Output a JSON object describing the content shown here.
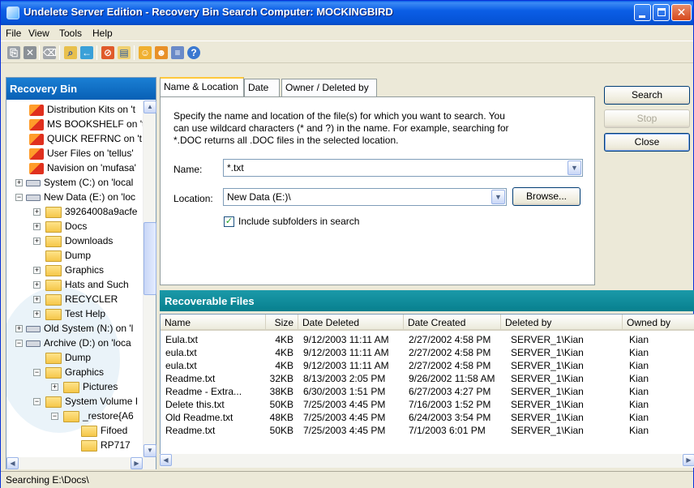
{
  "window": {
    "title": "Undelete Server Edition - Recovery Bin Search   Computer: MOCKINGBIRD"
  },
  "menu": [
    "File",
    "View",
    "Tools",
    "Help"
  ],
  "toolbar_icons": [
    "recover-icon",
    "delete-icon",
    "purge-icon",
    "search-icon",
    "back-icon",
    "filter-icon",
    "properties-icon",
    "users-icon",
    "user-settings-icon",
    "options-icon",
    "help-icon"
  ],
  "recovery_bin": {
    "header": "Recovery Bin",
    "tree": [
      {
        "label": "Distribution Kits on 't",
        "icon": "recovery-bin-icon"
      },
      {
        "label": "MS BOOKSHELF on 't",
        "icon": "recovery-bin-icon"
      },
      {
        "label": "QUICK REFRNC on 't",
        "icon": "recovery-bin-icon"
      },
      {
        "label": "User Files on 'tellus'",
        "icon": "recovery-bin-icon"
      },
      {
        "label": "Navision on 'mufasa'",
        "icon": "recovery-bin-icon"
      },
      {
        "label": "System (C:) on 'local",
        "icon": "drive-icon"
      },
      {
        "label": "New Data (E:) on 'loc",
        "icon": "drive-icon"
      },
      {
        "label": "39264008a9acfe",
        "icon": "folder-icon"
      },
      {
        "label": "Docs",
        "icon": "folder-icon"
      },
      {
        "label": "Downloads",
        "icon": "folder-icon"
      },
      {
        "label": "Dump",
        "icon": "folder-icon"
      },
      {
        "label": "Graphics",
        "icon": "folder-icon"
      },
      {
        "label": "Hats and Such",
        "icon": "folder-icon"
      },
      {
        "label": "RECYCLER",
        "icon": "folder-icon"
      },
      {
        "label": "Test Help",
        "icon": "folder-icon"
      },
      {
        "label": "Old System (N:) on 'l",
        "icon": "drive-icon"
      },
      {
        "label": "Archive (D:) on 'loca",
        "icon": "drive-icon"
      },
      {
        "label": "Dump",
        "icon": "folder-icon"
      },
      {
        "label": "Graphics",
        "icon": "folder-icon"
      },
      {
        "label": "Pictures",
        "icon": "folder-icon"
      },
      {
        "label": "System Volume I",
        "icon": "folder-icon"
      },
      {
        "label": "_restore{A6",
        "icon": "folder-icon"
      },
      {
        "label": "Fifoed",
        "icon": "folder-icon"
      },
      {
        "label": "RP717",
        "icon": "folder-icon"
      }
    ]
  },
  "tabs": [
    "Name & Location",
    "Date",
    "Owner / Deleted by"
  ],
  "search_form": {
    "description": "Specify the name and location of the file(s) for which you want to search. You can use wildcard characters (* and ?) in the name. For example, searching for *.DOC returns all .DOC files in the selected location.",
    "name_label": "Name:",
    "name_value": "*.txt",
    "location_label": "Location:",
    "location_value": "New Data (E:)\\",
    "browse_label": "Browse...",
    "include_subfolders_label": "Include subfolders in search",
    "include_subfolders_checked": true
  },
  "actions": {
    "search": "Search",
    "stop": "Stop",
    "close": "Close"
  },
  "results": {
    "header": "Recoverable Files",
    "columns": [
      "Name",
      "Size",
      "Date Deleted",
      "Date Created",
      "Deleted by",
      "Owned by"
    ],
    "rows": [
      [
        "Eula.txt",
        "4KB",
        "9/12/2003 11:11 AM",
        "2/27/2002 4:58 PM",
        "SERVER_1\\Kian",
        "Kian"
      ],
      [
        "eula.txt",
        "4KB",
        "9/12/2003 11:11 AM",
        "2/27/2002 4:58 PM",
        "SERVER_1\\Kian",
        "Kian"
      ],
      [
        "eula.txt",
        "4KB",
        "9/12/2003 11:11 AM",
        "2/27/2002 4:58 PM",
        "SERVER_1\\Kian",
        "Kian"
      ],
      [
        "Readme.txt",
        "32KB",
        "8/13/2003 2:05 PM",
        "9/26/2002 11:58 AM",
        "SERVER_1\\Kian",
        "Kian"
      ],
      [
        "Readme - Extra...",
        "38KB",
        "6/30/2003 1:51 PM",
        "6/27/2003 4:27 PM",
        "SERVER_1\\Kian",
        "Kian"
      ],
      [
        "Delete this.txt",
        "50KB",
        "7/25/2003 4:45 PM",
        "7/16/2003 1:52 PM",
        "SERVER_1\\Kian",
        "Kian"
      ],
      [
        "Old Readme.txt",
        "48KB",
        "7/25/2003 4:45 PM",
        "6/24/2003 3:54 PM",
        "SERVER_1\\Kian",
        "Kian"
      ],
      [
        "Readme.txt",
        "50KB",
        "7/25/2003 4:45 PM",
        "7/1/2003 6:01 PM",
        "SERVER_1\\Kian",
        "Kian"
      ]
    ]
  },
  "status": "Searching E:\\Docs\\",
  "colors": {
    "titlebar": "#0553d6",
    "left_header": "#0860b5",
    "results_header": "#07808e"
  }
}
